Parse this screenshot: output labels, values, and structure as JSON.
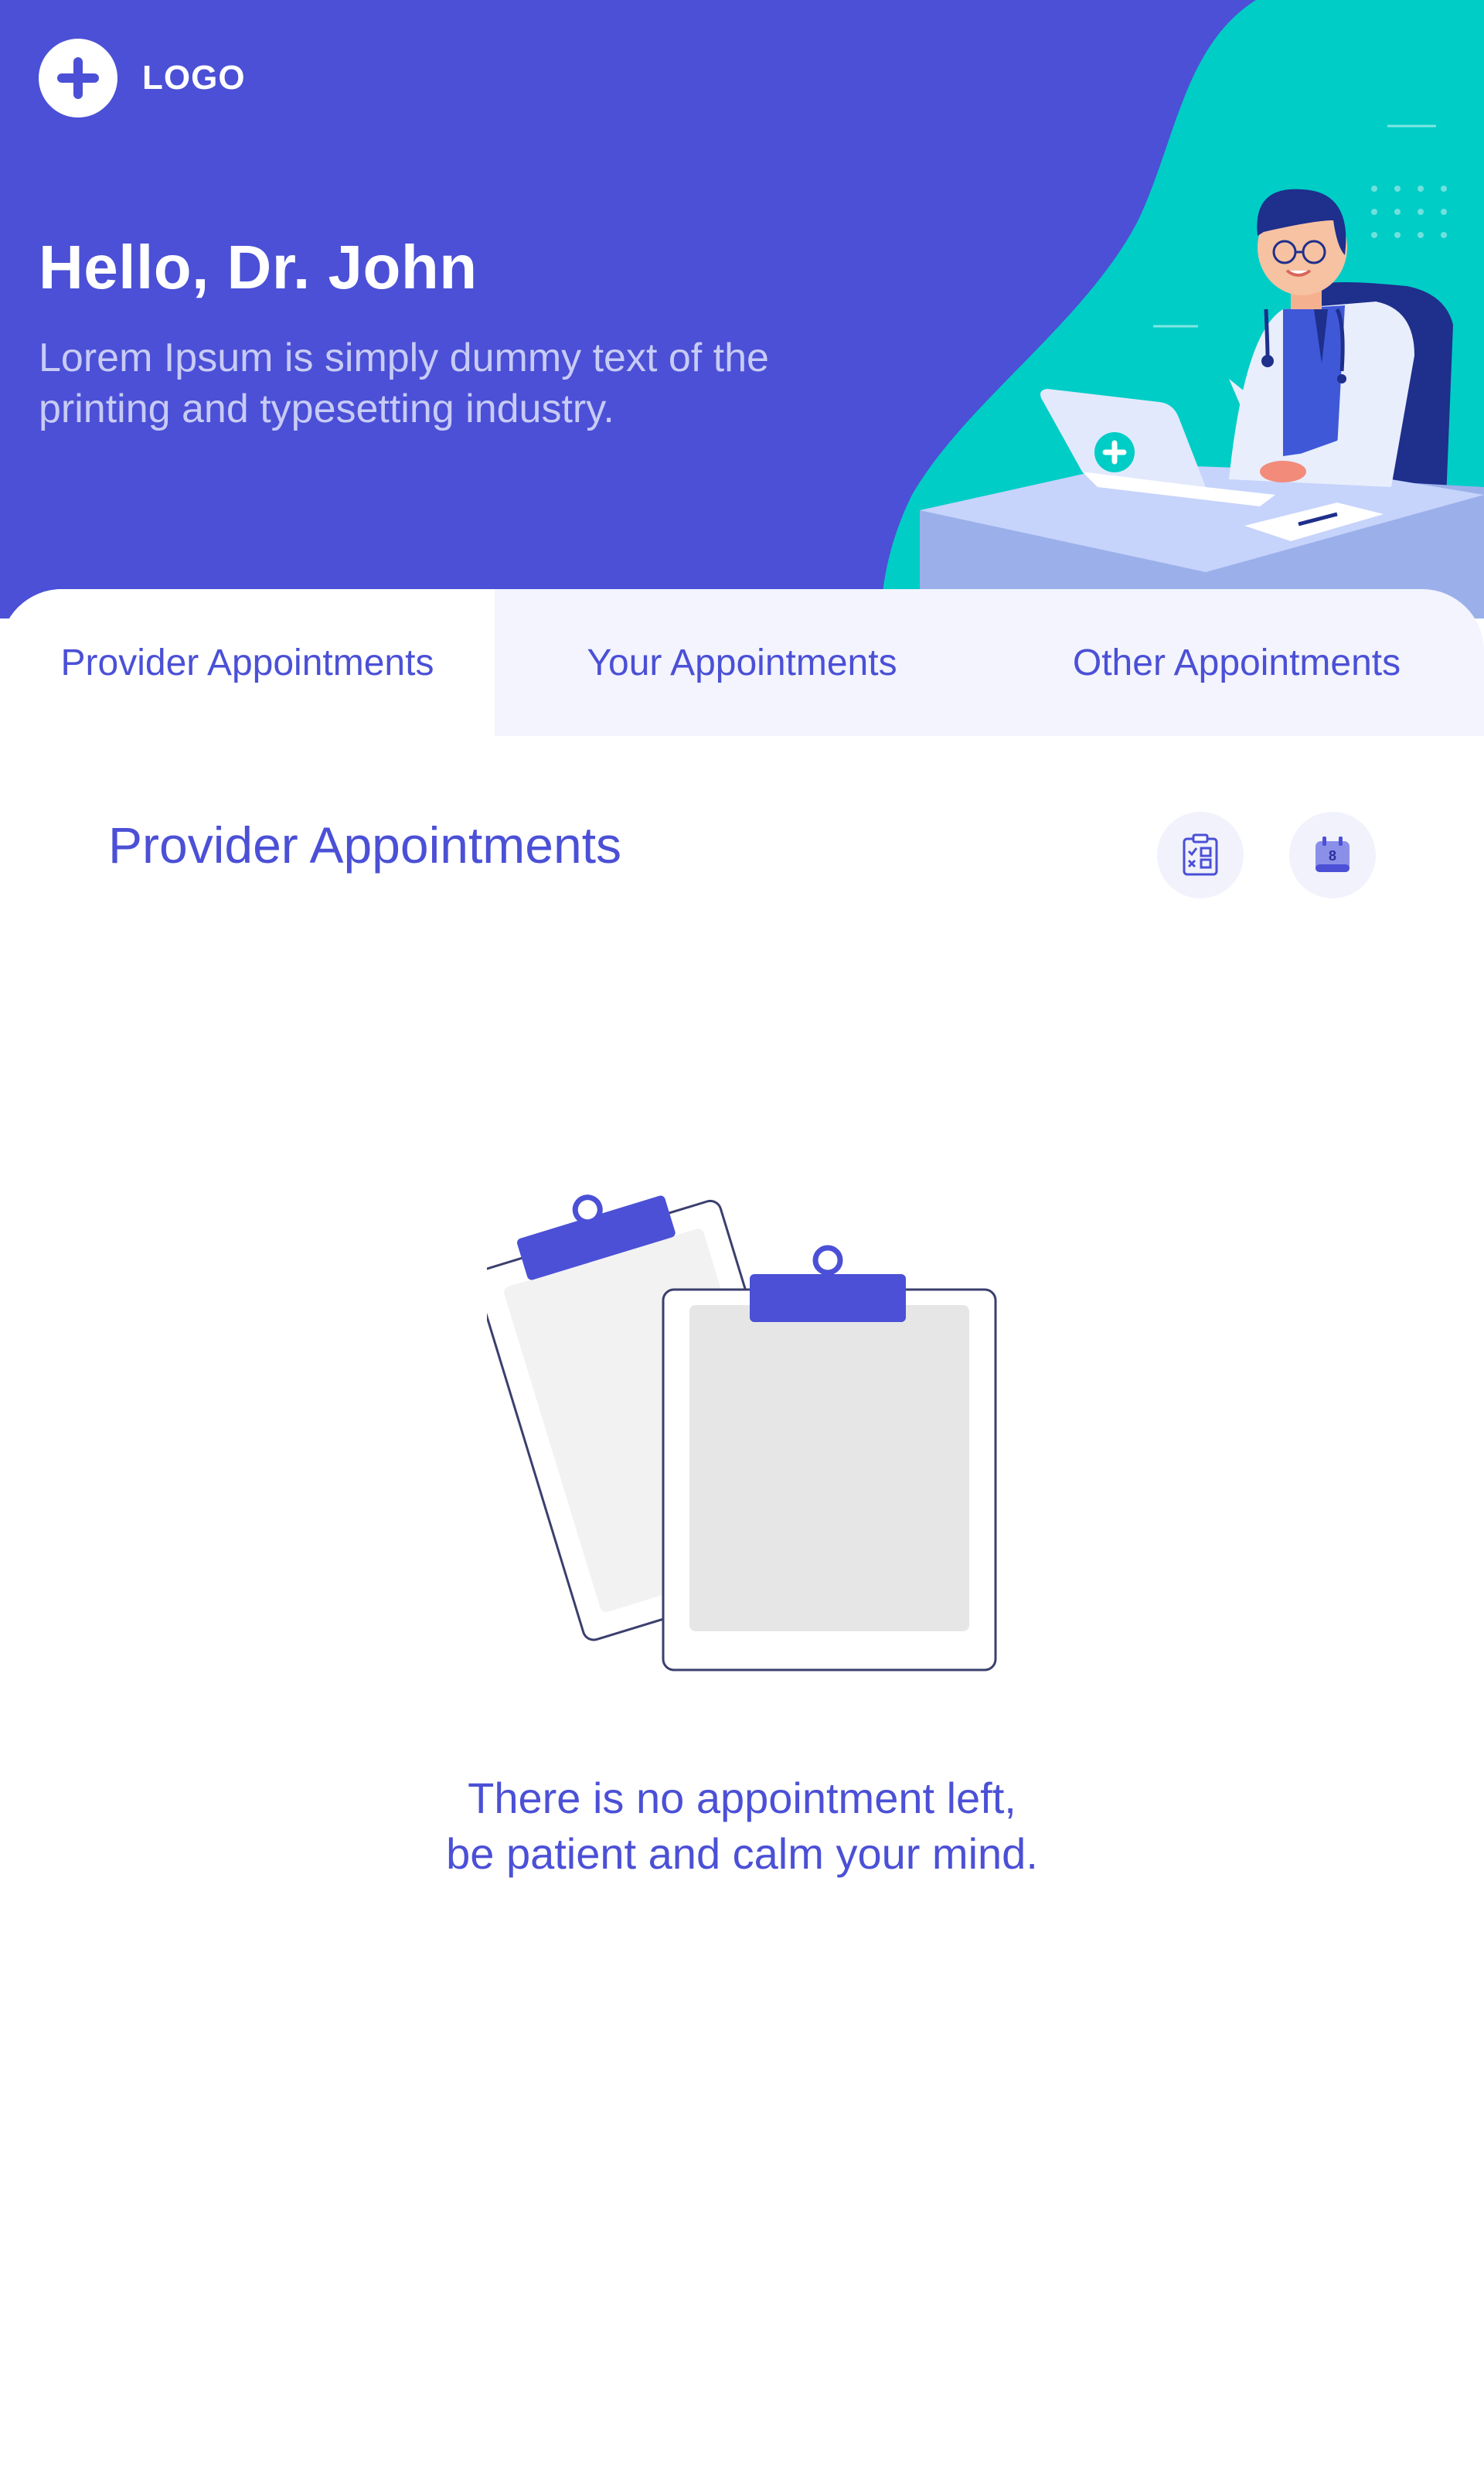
{
  "header": {
    "logo_text": "LOGO",
    "greeting": "Hello, Dr. John",
    "subtitle": "Lorem Ipsum is simply dummy text of the printing and typesetting industry."
  },
  "tabs": [
    {
      "label": "Provider Appointments",
      "active": true
    },
    {
      "label": "Your Appointments",
      "active": false
    },
    {
      "label": "Other Appointments",
      "active": false
    }
  ],
  "section": {
    "title": "Provider Appointments",
    "actions": [
      {
        "icon": "checklist-icon"
      },
      {
        "icon": "calendar-icon",
        "badge": "8"
      }
    ]
  },
  "empty_state": {
    "line1": "There is no appointment left,",
    "line2": "be patient and calm your mind."
  },
  "colors": {
    "primary": "#4b50d6",
    "accent": "#00cdc6",
    "tab_bg": "#f3f4fd"
  }
}
